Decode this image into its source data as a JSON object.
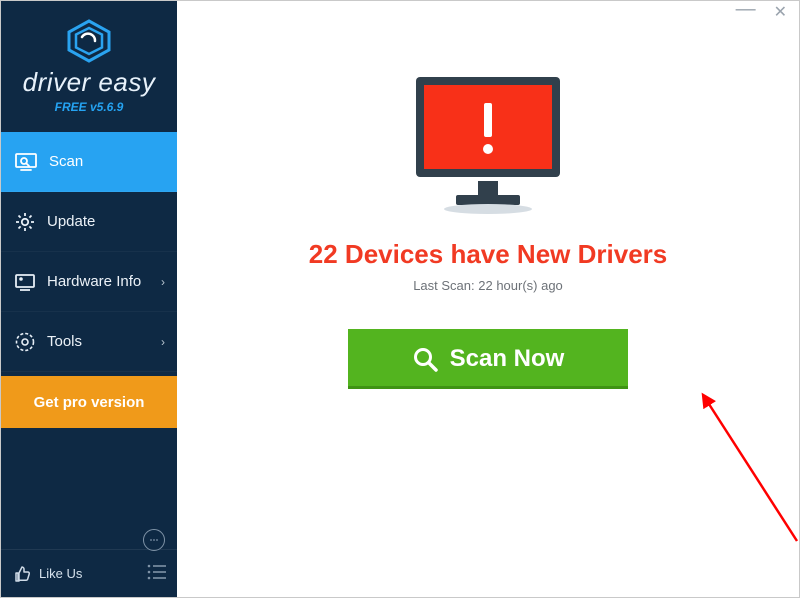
{
  "brand": {
    "name": "driver easy",
    "version": "FREE v5.6.9"
  },
  "sidebar": {
    "items": [
      {
        "label": "Scan",
        "icon": "scan-icon",
        "active": true,
        "submenu": false
      },
      {
        "label": "Update",
        "icon": "gear-icon",
        "active": false,
        "submenu": false
      },
      {
        "label": "Hardware Info",
        "icon": "hardware-icon",
        "active": false,
        "submenu": true
      },
      {
        "label": "Tools",
        "icon": "tools-icon",
        "active": false,
        "submenu": true
      }
    ],
    "pro_button": "Get pro version",
    "like_us": "Like Us"
  },
  "main": {
    "headline_count": "22",
    "headline_text": "Devices have New Drivers",
    "last_scan": "Last Scan: 22 hour(s) ago",
    "scan_button": "Scan Now"
  }
}
